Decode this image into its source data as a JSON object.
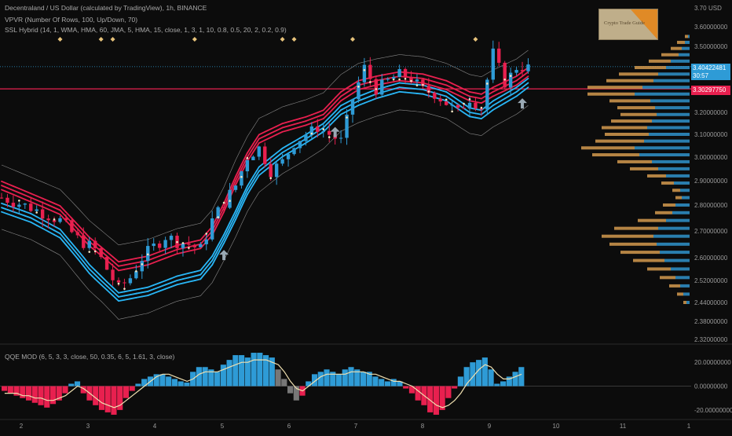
{
  "header": {
    "title": "Decentraland / US Dollar (calculated by TradingView), 1h, BINANCE",
    "vpvr_label": "VPVR (Number Of Rows, 100, Up/Down, 70)",
    "ssl_label": "SSL Hybrid (14, 1, WMA, HMA, 60, JMA, 5, HMA, 15, close, 1, 3, 1, 10, 0.8, 0.5, 20, 2, 0.2, 0.9)",
    "qqe_label": "QQE MOD (6, 5, 3, 3, close, 50, 0.35, 6, 5, 1.61, 3, close)",
    "currency": "USD",
    "logo_text": "Crypto Trade Guide"
  },
  "price_tags": {
    "current_price": "3.40422481",
    "countdown": "30:57",
    "ssl_line": "3.30297750"
  },
  "colors": {
    "background": "#0c0c0c",
    "up": "#2e9bd6",
    "down": "#e8204f",
    "ssl_blue": "#29b6f6",
    "ssl_red": "#e8204f",
    "vp_up": "#2e8bc0",
    "vp_down": "#c8914a",
    "qqe_grey": "#777777",
    "qqe_line": "#f0e0b0",
    "signal_diamond": "#e6c27a",
    "dots": "#f2e6c4"
  },
  "chart_data": [
    {
      "type": "candlestick",
      "title": "Decentraland / US Dollar (calculated by TradingView), 1h, BINANCE",
      "x_ticks": [
        "2",
        "3",
        "4",
        "5",
        "6",
        "7",
        "8",
        "9",
        "10",
        "11",
        "1"
      ],
      "y_ticks": [
        "3.70",
        "3.60000000",
        "3.50000000",
        "3.40000000",
        "3.30000000",
        "3.20000000",
        "3.10000000",
        "3.00000000",
        "2.90000000",
        "2.80000000",
        "2.70000000",
        "2.60000000",
        "2.52000000",
        "2.44000000",
        "2.38000000",
        "2.32000000"
      ],
      "ylim": [
        2.31,
        3.71
      ],
      "y_scale": "log",
      "price_path": [
        [
          0,
          2.83
        ],
        [
          5,
          2.79
        ],
        [
          10,
          2.74
        ],
        [
          13,
          2.67
        ],
        [
          16,
          2.63
        ],
        [
          18,
          2.56
        ],
        [
          20,
          2.49
        ],
        [
          22,
          2.53
        ],
        [
          24,
          2.6
        ],
        [
          26,
          2.64
        ],
        [
          28,
          2.68
        ],
        [
          30,
          2.66
        ],
        [
          32,
          2.65
        ],
        [
          34,
          2.63
        ],
        [
          36,
          2.74
        ],
        [
          38,
          2.81
        ],
        [
          40,
          2.88
        ],
        [
          42,
          3.0
        ],
        [
          44,
          3.04
        ],
        [
          46,
          2.94
        ],
        [
          48,
          2.98
        ],
        [
          50,
          3.06
        ],
        [
          52,
          3.1
        ],
        [
          54,
          3.13
        ],
        [
          56,
          3.1
        ],
        [
          58,
          3.07
        ],
        [
          60,
          3.26
        ],
        [
          62,
          3.4
        ],
        [
          64,
          3.3
        ],
        [
          66,
          3.34
        ],
        [
          68,
          3.37
        ],
        [
          70,
          3.35
        ],
        [
          72,
          3.3
        ],
        [
          74,
          3.28
        ],
        [
          76,
          3.24
        ],
        [
          78,
          3.2
        ],
        [
          80,
          3.26
        ],
        [
          82,
          3.22
        ],
        [
          84,
          3.47
        ],
        [
          86,
          3.33
        ],
        [
          88,
          3.4
        ],
        [
          90,
          3.4
        ]
      ],
      "ssl_hybrid": {
        "lower_band": [
          [
            0,
            2.79
          ],
          [
            5,
            2.75
          ],
          [
            10,
            2.69
          ],
          [
            15,
            2.56
          ],
          [
            20,
            2.46
          ],
          [
            25,
            2.48
          ],
          [
            30,
            2.52
          ],
          [
            34,
            2.54
          ],
          [
            36,
            2.59
          ],
          [
            38,
            2.67
          ],
          [
            40,
            2.76
          ],
          [
            42,
            2.86
          ],
          [
            44,
            2.94
          ],
          [
            48,
            3.02
          ],
          [
            52,
            3.08
          ],
          [
            55,
            3.13
          ],
          [
            58,
            3.21
          ],
          [
            61,
            3.25
          ],
          [
            64,
            3.28
          ],
          [
            68,
            3.31
          ],
          [
            72,
            3.3
          ],
          [
            76,
            3.27
          ],
          [
            80,
            3.2
          ],
          [
            82,
            3.19
          ],
          [
            84,
            3.23
          ],
          [
            88,
            3.29
          ],
          [
            90,
            3.33
          ]
        ],
        "upper_band": [
          [
            0,
            2.88
          ],
          [
            5,
            2.83
          ],
          [
            10,
            2.78
          ],
          [
            15,
            2.66
          ],
          [
            20,
            2.57
          ],
          [
            25,
            2.59
          ],
          [
            30,
            2.63
          ],
          [
            34,
            2.65
          ],
          [
            36,
            2.7
          ],
          [
            38,
            2.79
          ],
          [
            40,
            2.9
          ],
          [
            42,
            3.0
          ],
          [
            44,
            3.08
          ],
          [
            48,
            3.13
          ],
          [
            52,
            3.16
          ],
          [
            55,
            3.19
          ],
          [
            58,
            3.27
          ],
          [
            61,
            3.32
          ],
          [
            64,
            3.34
          ],
          [
            68,
            3.36
          ],
          [
            72,
            3.35
          ],
          [
            76,
            3.32
          ],
          [
            80,
            3.27
          ],
          [
            82,
            3.26
          ],
          [
            84,
            3.29
          ],
          [
            88,
            3.34
          ],
          [
            90,
            3.38
          ]
        ]
      },
      "signal_diamonds_x": [
        10,
        17,
        19,
        33,
        48,
        50,
        60,
        81
      ],
      "arrow_signals_x": [
        38,
        57,
        89
      ]
    },
    {
      "type": "histogram",
      "name": "VPVR",
      "price_levels": [
        3.55,
        3.52,
        3.49,
        3.46,
        3.43,
        3.4,
        3.37,
        3.34,
        3.31,
        3.28,
        3.25,
        3.22,
        3.19,
        3.16,
        3.13,
        3.1,
        3.07,
        3.04,
        3.01,
        2.98,
        2.95,
        2.92,
        2.89,
        2.86,
        2.83,
        2.8,
        2.77,
        2.74,
        2.71,
        2.68,
        2.65,
        2.62,
        2.59,
        2.56,
        2.53,
        2.5,
        2.47,
        2.44
      ],
      "up_volume": [
        2,
        6,
        10,
        14,
        24,
        30,
        40,
        46,
        60,
        70,
        50,
        44,
        42,
        48,
        54,
        52,
        58,
        70,
        64,
        48,
        40,
        30,
        20,
        12,
        10,
        18,
        22,
        30,
        40,
        46,
        42,
        38,
        32,
        24,
        18,
        12,
        8,
        4
      ],
      "down_volume": [
        4,
        10,
        14,
        22,
        28,
        40,
        50,
        60,
        70,
        60,
        52,
        48,
        46,
        52,
        58,
        56,
        62,
        68,
        60,
        44,
        36,
        24,
        16,
        10,
        8,
        16,
        22,
        36,
        56,
        66,
        60,
        50,
        40,
        30,
        20,
        14,
        8,
        4
      ]
    },
    {
      "type": "bar",
      "name": "QQE MOD",
      "y_ticks": [
        "20.00000000",
        "0.00000000",
        "-20.00000000"
      ],
      "ylim": [
        -28,
        30
      ],
      "values": [
        -4,
        -6,
        -8,
        -10,
        -12,
        -14,
        -16,
        -18,
        -15,
        -12,
        -6,
        2,
        4,
        -6,
        -12,
        -16,
        -20,
        -22,
        -24,
        -20,
        -10,
        -4,
        2,
        6,
        8,
        10,
        10,
        8,
        6,
        4,
        3,
        12,
        16,
        16,
        14,
        12,
        18,
        22,
        26,
        26,
        24,
        28,
        28,
        26,
        24,
        14,
        6,
        -6,
        -12,
        -8,
        4,
        10,
        12,
        14,
        12,
        10,
        14,
        16,
        14,
        12,
        12,
        8,
        6,
        4,
        6,
        4,
        -2,
        -6,
        -12,
        -16,
        -22,
        -24,
        -20,
        -10,
        -2,
        8,
        16,
        20,
        22,
        24,
        14,
        2,
        4,
        8,
        12,
        16
      ],
      "grey_range": [
        45,
        48
      ],
      "line": [
        -6,
        -6,
        -6,
        -8,
        -8,
        -10,
        -10,
        -12,
        -12,
        -10,
        -8,
        -4,
        0,
        -2,
        -6,
        -10,
        -14,
        -16,
        -18,
        -16,
        -12,
        -8,
        -4,
        0,
        4,
        8,
        10,
        10,
        8,
        6,
        4,
        6,
        10,
        12,
        12,
        12,
        14,
        16,
        18,
        20,
        20,
        22,
        22,
        22,
        20,
        18,
        12,
        4,
        -2,
        -4,
        0,
        4,
        8,
        10,
        10,
        10,
        10,
        12,
        12,
        12,
        10,
        10,
        8,
        6,
        4,
        4,
        2,
        0,
        -4,
        -8,
        -12,
        -16,
        -18,
        -16,
        -12,
        -6,
        2,
        8,
        14,
        18,
        16,
        10,
        6,
        6,
        8,
        10
      ]
    }
  ]
}
